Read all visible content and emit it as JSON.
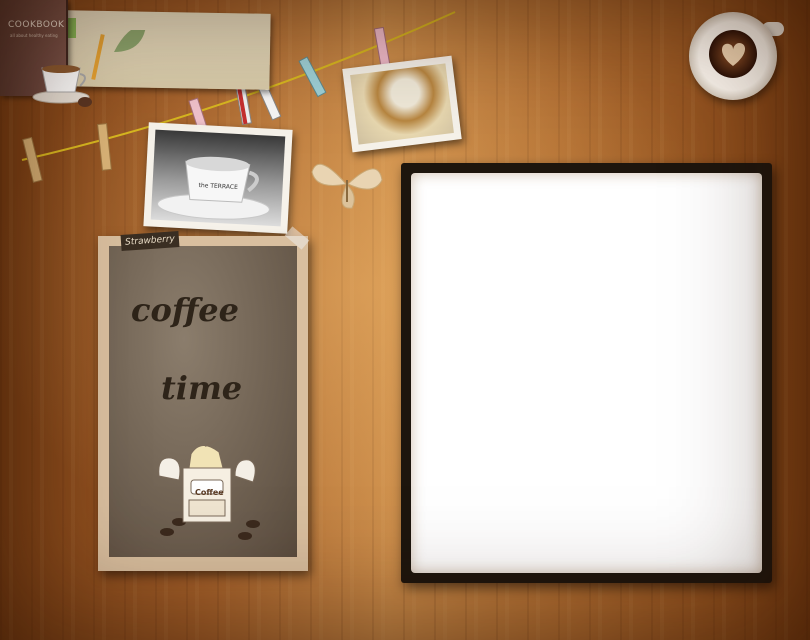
{
  "cookbook": {
    "title": "COOKBOOK",
    "subtitle": "all about healthy eating"
  },
  "tag": {
    "label": "Strawberry"
  },
  "card": {
    "line1": "coffee",
    "line2": "time",
    "grinder_label": "Coffee"
  },
  "photo_cup": {
    "cup_text": "the TERRACE"
  },
  "colors": {
    "string": "#d8b820",
    "desk": "#a4602a",
    "frame": "#1d150d"
  },
  "icons": [
    "coffee-cup-icon",
    "leaf-icon",
    "pencil-icon",
    "butterfly-icon",
    "coffee-grinder-icon",
    "heart-latte-icon",
    "clothespin-icon"
  ]
}
